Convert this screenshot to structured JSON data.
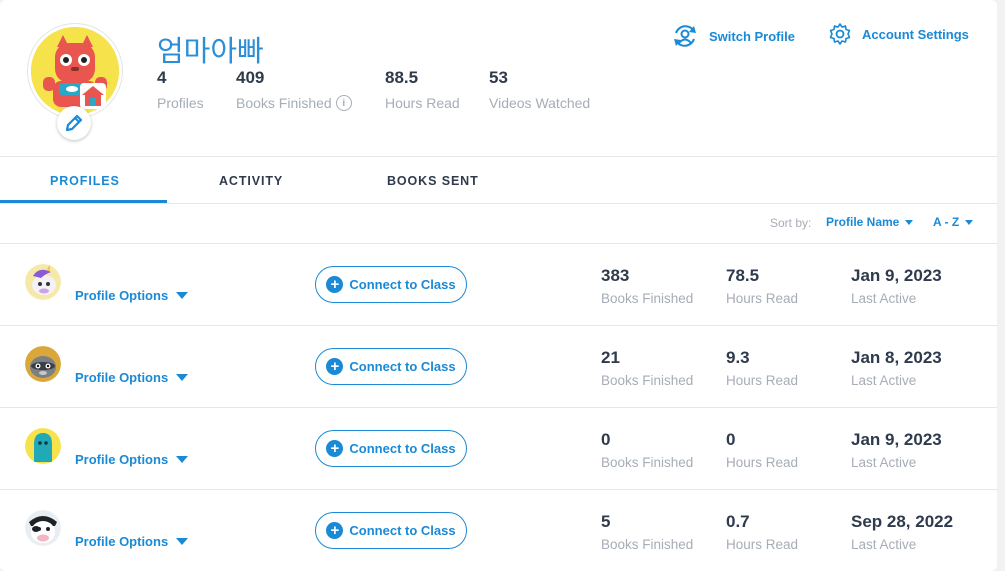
{
  "header": {
    "display_name": "엄마아빠",
    "stats": [
      {
        "value": "4",
        "label": "Profiles"
      },
      {
        "value": "409",
        "label": "Books Finished"
      },
      {
        "value": "88.5",
        "label": "Hours Read"
      },
      {
        "value": "53",
        "label": "Videos Watched"
      }
    ],
    "switch_profile": "Switch Profile",
    "account_settings": "Account Settings"
  },
  "tabs": [
    {
      "label": "PROFILES",
      "active": true
    },
    {
      "label": "ACTIVITY",
      "active": false
    },
    {
      "label": "BOOKS SENT",
      "active": false
    }
  ],
  "sort": {
    "label": "Sort by:",
    "field": "Profile Name",
    "order": "A - Z"
  },
  "profiles": [
    {
      "options_label": "Profile Options",
      "connect_label": "Connect to Class",
      "books_finished": "383",
      "books_label": "Books Finished",
      "hours_read": "78.5",
      "hours_label": "Hours Read",
      "last_active": "Jan 9, 2023",
      "last_active_label": "Last Active",
      "avatar": "unicorn-avatar"
    },
    {
      "options_label": "Profile Options",
      "connect_label": "Connect to Class",
      "books_finished": "21",
      "books_label": "Books Finished",
      "hours_read": "9.3",
      "hours_label": "Hours Read",
      "last_active": "Jan 8, 2023",
      "last_active_label": "Last Active",
      "avatar": "raccoon-avatar"
    },
    {
      "options_label": "Profile Options",
      "connect_label": "Connect to Class",
      "books_finished": "0",
      "books_label": "Books Finished",
      "hours_read": "0",
      "hours_label": "Hours Read",
      "last_active": "Jan 9, 2023",
      "last_active_label": "Last Active",
      "avatar": "teal-monster-avatar"
    },
    {
      "options_label": "Profile Options",
      "connect_label": "Connect to Class",
      "books_finished": "5",
      "books_label": "Books Finished",
      "hours_read": "0.7",
      "hours_label": "Hours Read",
      "last_active": "Sep 28, 2022",
      "last_active_label": "Last Active",
      "avatar": "cow-avatar"
    }
  ],
  "colors": {
    "accent": "#1a8ad6",
    "text": "#2f3b4c",
    "muted": "#a6adb6"
  }
}
